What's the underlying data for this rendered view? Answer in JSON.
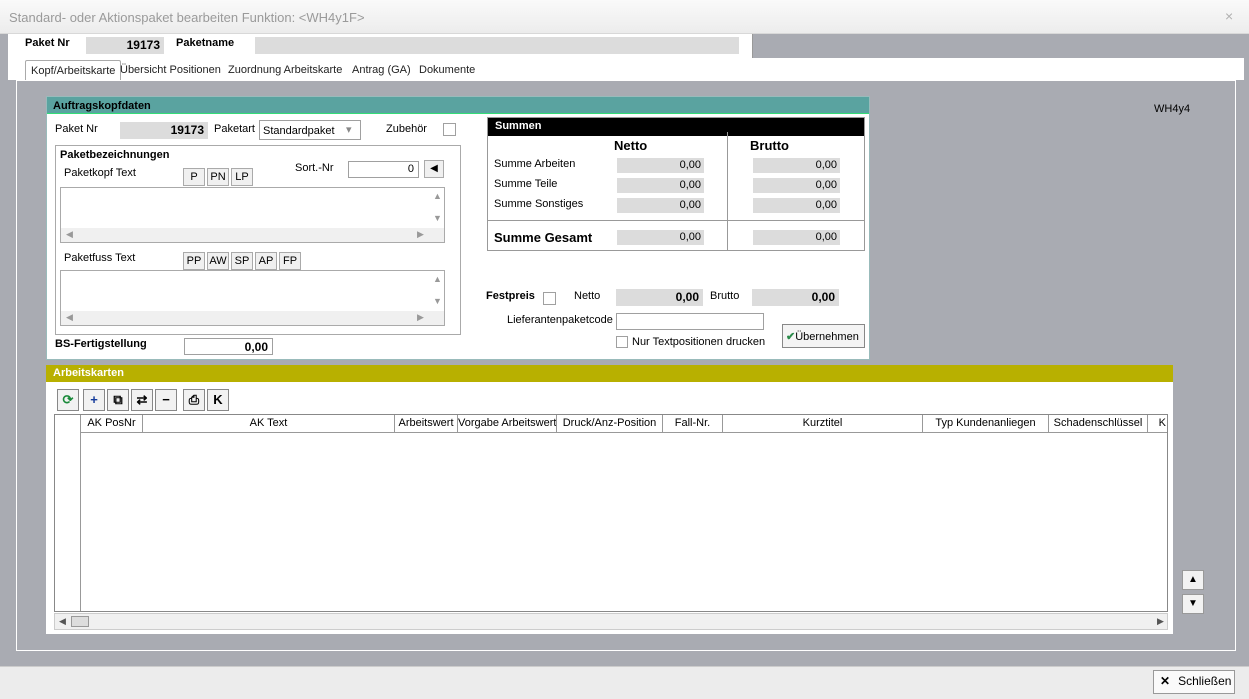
{
  "window": {
    "title": "Standard- oder Aktionspaket bearbeiten   Funktion: <WH4y1F>",
    "close_glyph": "×"
  },
  "header": {
    "paket_nr_label": "Paket Nr",
    "paket_nr": "19173",
    "paketname_label": "Paketname",
    "paketname": ""
  },
  "tabs": [
    "Kopf/Arbeitskarte",
    "Übersicht Positionen",
    "Zuordnung Arbeitskarte",
    "Antrag (GA)",
    "Dokumente"
  ],
  "screen_code": "WH4y4",
  "kopf": {
    "title": "Auftragskopfdaten",
    "paket_nr_label": "Paket Nr",
    "paket_nr": "19173",
    "paketart_label": "Paketart",
    "paketart": "Standardpaket",
    "zubehoer_label": "Zubehör",
    "bez_title": "Paketbezeichnungen",
    "kopf_text_label": "Paketkopf Text",
    "kopf_buttons": [
      "P",
      "PN",
      "LP"
    ],
    "sort_label": "Sort.-Nr",
    "sort_value": "0",
    "fuss_text_label": "Paketfuss Text",
    "fuss_buttons": [
      "PP",
      "AW",
      "SP",
      "AP",
      "FP"
    ],
    "bs_label": "BS-Fertigstellung",
    "bs_value": "0,00"
  },
  "summen": {
    "title": "Summen",
    "netto_label": "Netto",
    "brutto_label": "Brutto",
    "rows": [
      {
        "label": "Summe Arbeiten",
        "netto": "0,00",
        "brutto": "0,00"
      },
      {
        "label": "Summe Teile",
        "netto": "0,00",
        "brutto": "0,00"
      },
      {
        "label": "Summe Sonstiges",
        "netto": "0,00",
        "brutto": "0,00"
      }
    ],
    "gesamt_label": "Summe Gesamt",
    "gesamt_netto": "0,00",
    "gesamt_brutto": "0,00"
  },
  "festpreis": {
    "label": "Festpreis",
    "netto_label": "Netto",
    "netto": "0,00",
    "brutto_label": "Brutto",
    "brutto": "0,00"
  },
  "lieferant": {
    "label": "Lieferantenpaketcode",
    "value": ""
  },
  "nur_text_label": "Nur Textpositionen drucken",
  "uebernehmen_label": "Übernehmen",
  "arbeitskarten": {
    "title": "Arbeitskarten",
    "toolbar_icons": [
      "refresh-icon",
      "add-icon",
      "copy-icon",
      "transfer-icon",
      "remove-icon",
      "print-icon",
      "k-icon"
    ],
    "toolbar_glyphs": [
      "⟳",
      "+",
      "⧉",
      "⇄",
      "−",
      "⎙",
      "K"
    ],
    "columns": [
      "AK PosNr",
      "AK Text",
      "Arbeitswert",
      "Vorgabe Arbeitswert",
      "Druck/Anz-Position",
      "Fall-Nr.",
      "Kurztitel",
      "Typ Kundenanliegen",
      "Schadenschlüssel",
      "K"
    ]
  },
  "arrows": {
    "up": "▲",
    "down": "▼",
    "left": "◀",
    "right": "▶",
    "dropdown": "▾"
  },
  "footer": {
    "close_label": "Schließen",
    "close_glyph": "✕"
  }
}
